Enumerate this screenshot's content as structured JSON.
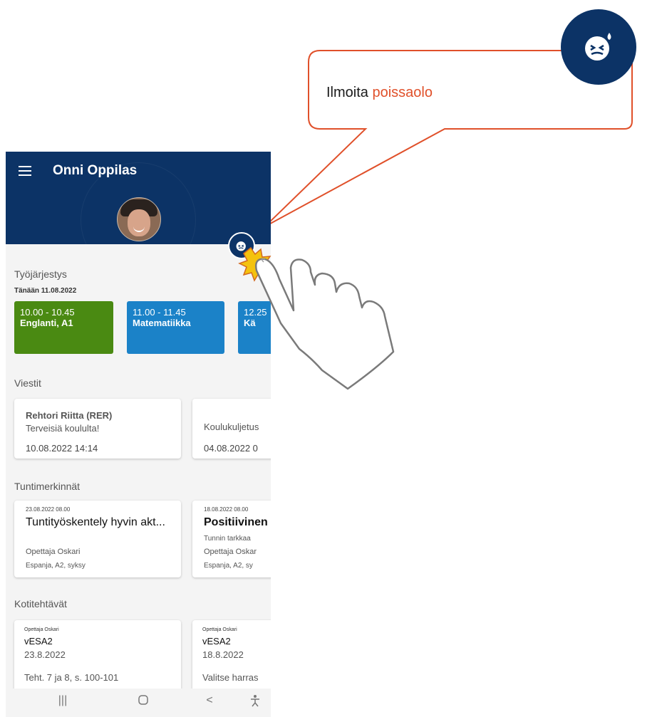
{
  "callout": {
    "text_plain": "Ilmoita",
    "text_highlight": "poissaolo",
    "accent_color": "#e0502a",
    "icon": "sick-face-icon"
  },
  "header": {
    "user_name": "Onni Oppilas",
    "menu_icon": "hamburger-menu-icon",
    "absence_button_icon": "sick-face-icon",
    "bg_color": "#0c3366"
  },
  "schedule": {
    "title": "Työjärjestys",
    "today_label": "Tänään 11.08.2022",
    "lessons": [
      {
        "time": "10.00 - 10.45",
        "name": "Englanti, A1",
        "color": "#4a8a12"
      },
      {
        "time": "11.00 - 11.45",
        "name": "Matematiikka",
        "color": "#1b82c8"
      },
      {
        "time": "12.25",
        "name": "Kä",
        "color": "#1b82c8"
      }
    ]
  },
  "messages": {
    "title": "Viestit",
    "items": [
      {
        "sender": "Rehtori Riitta (RER)",
        "subject": "Terveisiä koululta!",
        "date": "10.08.2022 14:14"
      },
      {
        "sender": "",
        "subject": "Koulukuljetus",
        "date": "04.08.2022 0"
      }
    ]
  },
  "lesson_entries": {
    "title": "Tuntimerkinnät",
    "items": [
      {
        "date": "23.08.2022 08.00",
        "title": "Tuntityöskentely hyvin akt...",
        "subtitle": "",
        "teacher": "Opettaja Oskari",
        "course": "Espanja, A2, syksy"
      },
      {
        "date": "18.08.2022 08.00",
        "title": "Positiivinen",
        "subtitle": "Tunnin tarkkaa",
        "teacher": "Opettaja Oskar",
        "course": "Espanja, A2, sy"
      }
    ]
  },
  "homework": {
    "title": "Kotitehtävät",
    "items": [
      {
        "teacher": "Opettaja Oskari",
        "title": "vESA2",
        "date": "23.8.2022",
        "desc": "Teht. 7 ja 8, s. 100-101"
      },
      {
        "teacher": "Opettaja Oskari",
        "title": "vESA2",
        "date": "18.8.2022",
        "desc": "Valitse harras"
      }
    ]
  },
  "navbar": {
    "recent": "|||",
    "home": "○",
    "back": "<",
    "accessibility": "accessibility-icon"
  }
}
